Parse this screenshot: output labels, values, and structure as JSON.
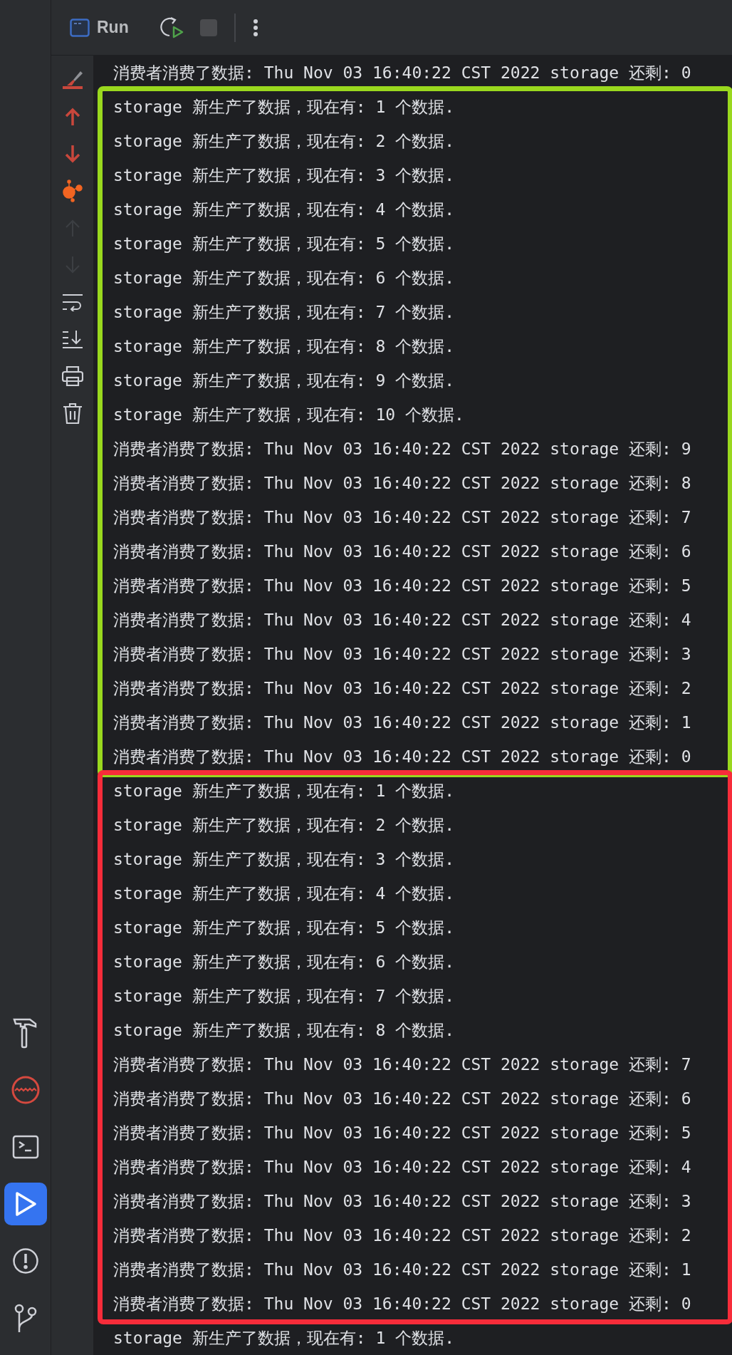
{
  "tool_windows": [
    {
      "kind": "build",
      "selected": false
    },
    {
      "kind": "profiler",
      "selected": false
    },
    {
      "kind": "terminal",
      "selected": false
    },
    {
      "kind": "run",
      "selected": true
    },
    {
      "kind": "problems",
      "selected": false
    },
    {
      "kind": "git",
      "selected": false
    }
  ],
  "run_toolbar": {
    "title": "Run"
  },
  "console_actions": [
    {
      "kind": "clear",
      "disabled": false
    },
    {
      "kind": "up-red",
      "disabled": false
    },
    {
      "kind": "down-red",
      "disabled": false
    },
    {
      "kind": "graph",
      "disabled": false
    },
    {
      "kind": "up",
      "disabled": true
    },
    {
      "kind": "down",
      "disabled": true
    },
    {
      "kind": "wrap",
      "disabled": false
    },
    {
      "kind": "scroll-end",
      "disabled": false
    },
    {
      "kind": "print",
      "disabled": false
    },
    {
      "kind": "trash",
      "disabled": false
    }
  ],
  "console": {
    "blocks": [
      {
        "lines": [
          "消费者消费了数据: Thu Nov 03 16:40:22 CST 2022 storage 还剩: 0"
        ]
      },
      {
        "color": "#9ad81e",
        "lines": [
          "storage 新生产了数据，现在有: 1 个数据.",
          "storage 新生产了数据，现在有: 2 个数据.",
          "storage 新生产了数据，现在有: 3 个数据.",
          "storage 新生产了数据，现在有: 4 个数据.",
          "storage 新生产了数据，现在有: 5 个数据.",
          "storage 新生产了数据，现在有: 6 个数据.",
          "storage 新生产了数据，现在有: 7 个数据.",
          "storage 新生产了数据，现在有: 8 个数据.",
          "storage 新生产了数据，现在有: 9 个数据.",
          "storage 新生产了数据，现在有: 10 个数据.",
          "消费者消费了数据: Thu Nov 03 16:40:22 CST 2022 storage 还剩: 9",
          "消费者消费了数据: Thu Nov 03 16:40:22 CST 2022 storage 还剩: 8",
          "消费者消费了数据: Thu Nov 03 16:40:22 CST 2022 storage 还剩: 7",
          "消费者消费了数据: Thu Nov 03 16:40:22 CST 2022 storage 还剩: 6",
          "消费者消费了数据: Thu Nov 03 16:40:22 CST 2022 storage 还剩: 5",
          "消费者消费了数据: Thu Nov 03 16:40:22 CST 2022 storage 还剩: 4",
          "消费者消费了数据: Thu Nov 03 16:40:22 CST 2022 storage 还剩: 3",
          "消费者消费了数据: Thu Nov 03 16:40:22 CST 2022 storage 还剩: 2",
          "消费者消费了数据: Thu Nov 03 16:40:22 CST 2022 storage 还剩: 1",
          "消费者消费了数据: Thu Nov 03 16:40:22 CST 2022 storage 还剩: 0"
        ]
      },
      {
        "color": "#f72c3a",
        "lines": [
          "storage 新生产了数据，现在有: 1 个数据.",
          "storage 新生产了数据，现在有: 2 个数据.",
          "storage 新生产了数据，现在有: 3 个数据.",
          "storage 新生产了数据，现在有: 4 个数据.",
          "storage 新生产了数据，现在有: 5 个数据.",
          "storage 新生产了数据，现在有: 6 个数据.",
          "storage 新生产了数据，现在有: 7 个数据.",
          "storage 新生产了数据，现在有: 8 个数据.",
          "消费者消费了数据: Thu Nov 03 16:40:22 CST 2022 storage 还剩: 7",
          "消费者消费了数据: Thu Nov 03 16:40:22 CST 2022 storage 还剩: 6",
          "消费者消费了数据: Thu Nov 03 16:40:22 CST 2022 storage 还剩: 5",
          "消费者消费了数据: Thu Nov 03 16:40:22 CST 2022 storage 还剩: 4",
          "消费者消费了数据: Thu Nov 03 16:40:22 CST 2022 storage 还剩: 3",
          "消费者消费了数据: Thu Nov 03 16:40:22 CST 2022 storage 还剩: 2",
          "消费者消费了数据: Thu Nov 03 16:40:22 CST 2022 storage 还剩: 1",
          "消费者消费了数据: Thu Nov 03 16:40:22 CST 2022 storage 还剩: 0"
        ]
      },
      {
        "lines": [
          "storage 新生产了数据，现在有: 1 个数据."
        ]
      }
    ]
  }
}
